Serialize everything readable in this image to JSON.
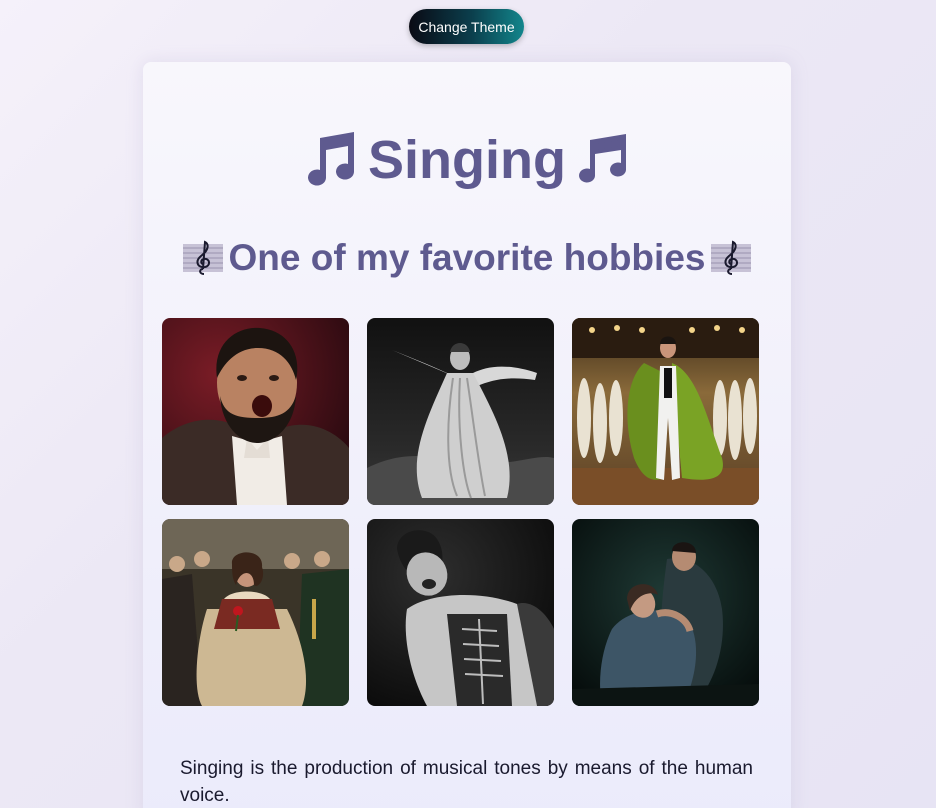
{
  "toolbar": {
    "change_theme_label": "Change Theme"
  },
  "header": {
    "title": "Singing",
    "subtitle": "One of my favorite hobbies",
    "title_icon_left": "musical-note-icon",
    "title_icon_right": "musical-notes-icon",
    "subtitle_icon": "musical-score-icon"
  },
  "gallery": {
    "photos": [
      {
        "name": "bearded-tenor-singing-photo",
        "style": "color"
      },
      {
        "name": "soprano-white-gown-photo",
        "style": "black-and-white"
      },
      {
        "name": "singer-green-gown-stage-photo",
        "style": "color"
      },
      {
        "name": "opera-scene-red-rose-photo",
        "style": "color"
      },
      {
        "name": "singer-laughing-corset-photo",
        "style": "black-and-white"
      },
      {
        "name": "opera-duet-embrace-photo",
        "style": "color"
      }
    ]
  },
  "body": {
    "description": "Singing is the production of musical tones by means of the human voice."
  },
  "colors": {
    "heading": "#5e5a8f",
    "button_gradient_start": "#0a0a14",
    "button_gradient_end": "#12868c"
  }
}
